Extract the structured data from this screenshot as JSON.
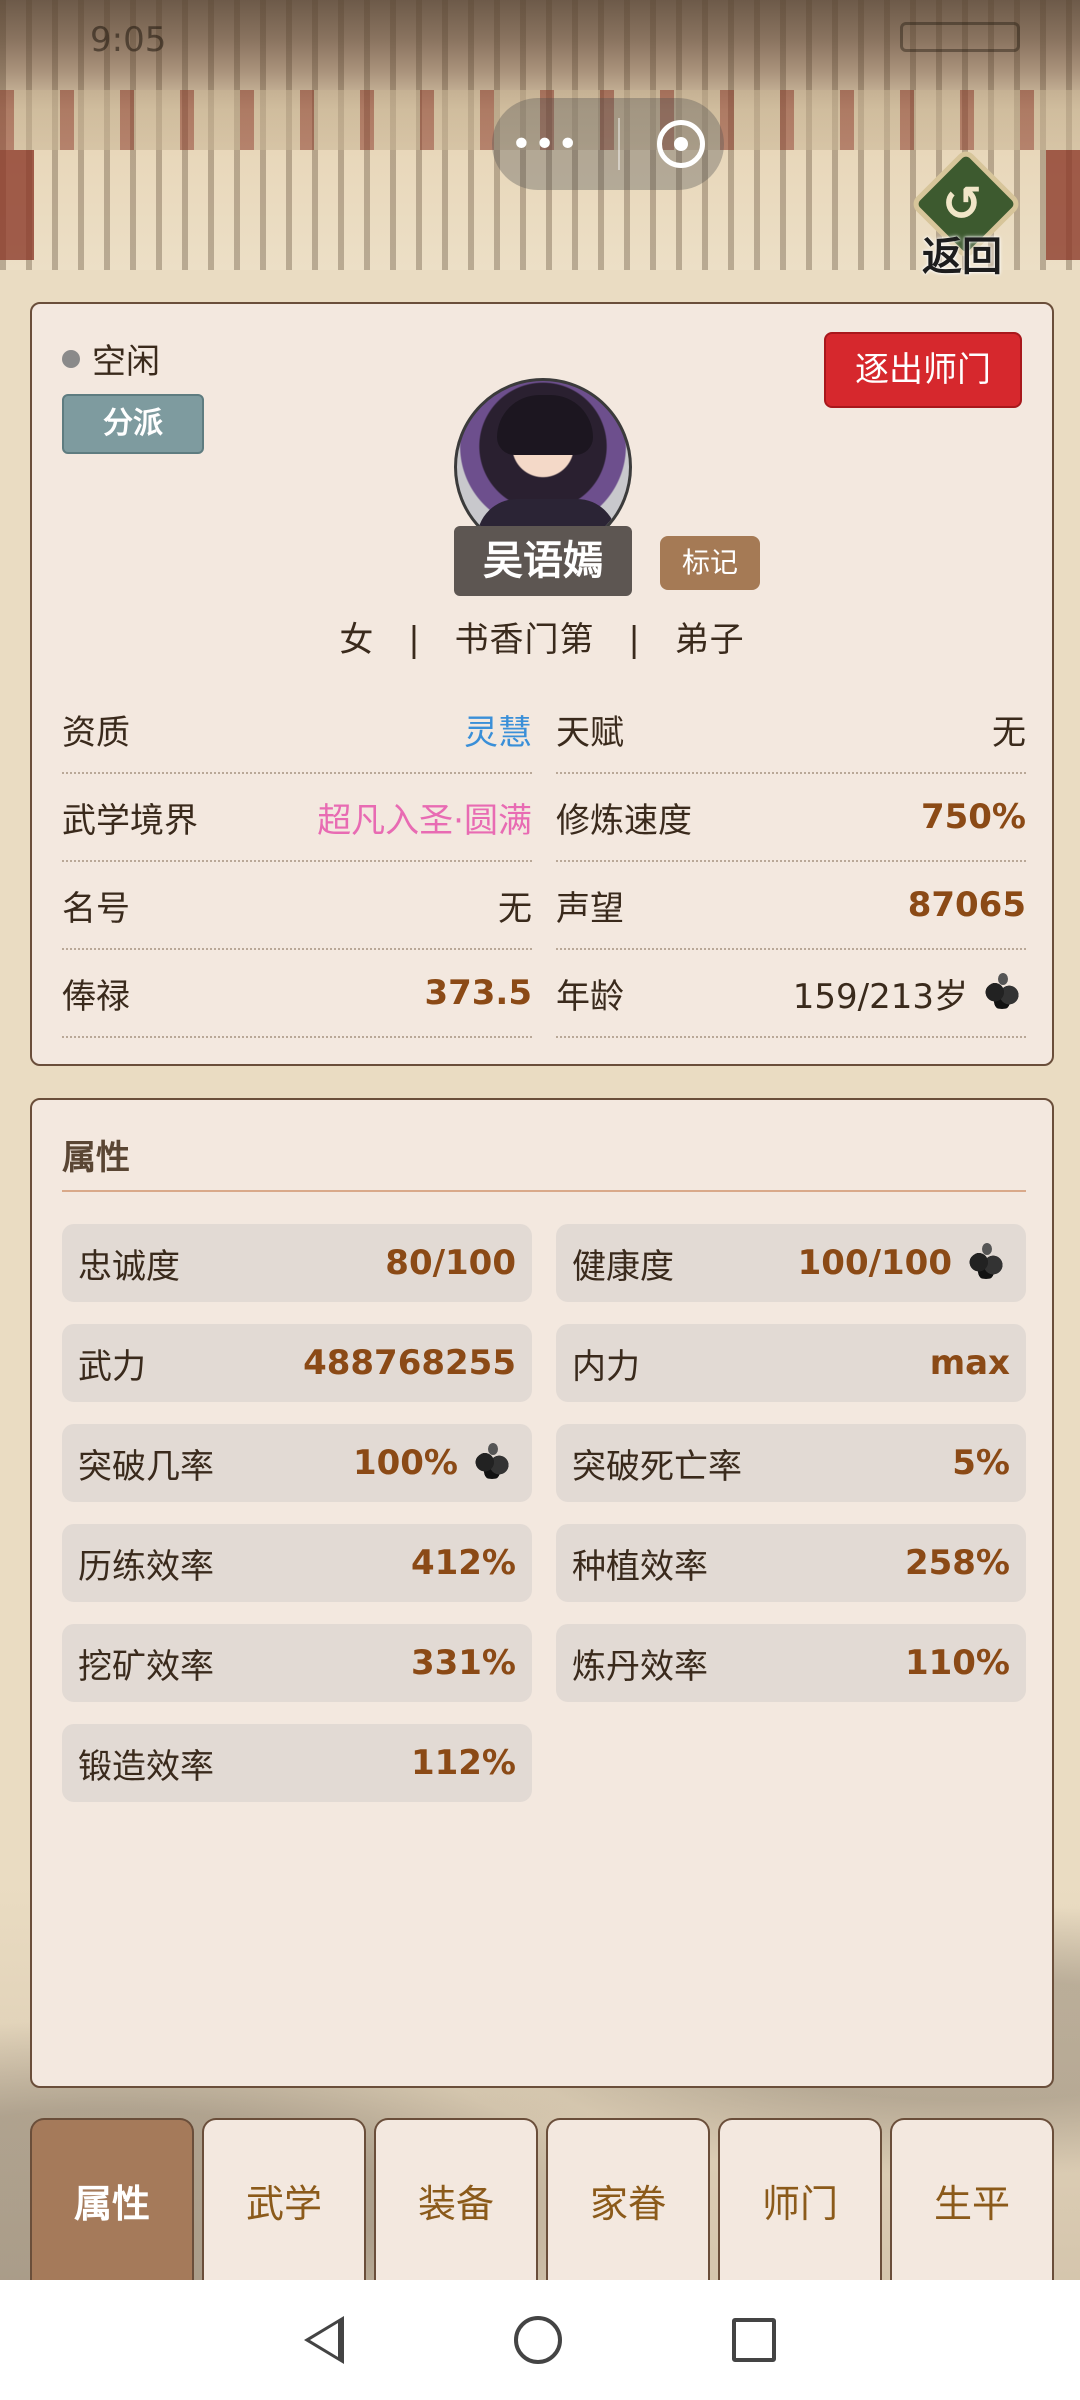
{
  "status_bar": {
    "time": "9:05"
  },
  "header": {
    "capsule_more": "•••",
    "back_label": "返回"
  },
  "profile": {
    "status": "空闲",
    "branch_button": "分派",
    "expel_button": "逐出师门",
    "name": "吴语嫣",
    "mark_button": "标记",
    "gender": "女",
    "background": "书香门第",
    "rank": "弟子",
    "separator": "|",
    "rows": [
      {
        "label": "资质",
        "value": "灵慧"
      },
      {
        "label": "天赋",
        "value": "无"
      },
      {
        "label": "武学境界",
        "value": "超凡入圣·圆满"
      },
      {
        "label": "修炼速度",
        "value": "750%"
      },
      {
        "label": "名号",
        "value": "无"
      },
      {
        "label": "声望",
        "value": "87065"
      },
      {
        "label": "俸禄",
        "value": "373.5"
      },
      {
        "label": "年龄",
        "value": "159/213岁",
        "icon": "ink-flower-icon"
      }
    ]
  },
  "attributes": {
    "title": "属性",
    "items": [
      {
        "label": "忠诚度",
        "value": "80/100"
      },
      {
        "label": "健康度",
        "value": "100/100",
        "icon": "ink-flower-icon"
      },
      {
        "label": "武力",
        "value": "488768255"
      },
      {
        "label": "内力",
        "value": "max"
      },
      {
        "label": "突破几率",
        "value": "100%",
        "icon": "ink-flower-icon"
      },
      {
        "label": "突破死亡率",
        "value": "5%"
      },
      {
        "label": "历练效率",
        "value": "412%"
      },
      {
        "label": "种植效率",
        "value": "258%"
      },
      {
        "label": "挖矿效率",
        "value": "331%"
      },
      {
        "label": "炼丹效率",
        "value": "110%"
      },
      {
        "label": "锻造效率",
        "value": "112%"
      }
    ]
  },
  "tabs": [
    {
      "label": "属性",
      "active": true
    },
    {
      "label": "武学"
    },
    {
      "label": "装备"
    },
    {
      "label": "家眷"
    },
    {
      "label": "师门"
    },
    {
      "label": "生平"
    }
  ],
  "colors": {
    "expel_red": "#d6282d",
    "value_brown": "#8b4a16",
    "aptitude_blue": "#3a8fd8",
    "realm_pink": "#e86bb3",
    "active_tab": "#a57a5a"
  }
}
